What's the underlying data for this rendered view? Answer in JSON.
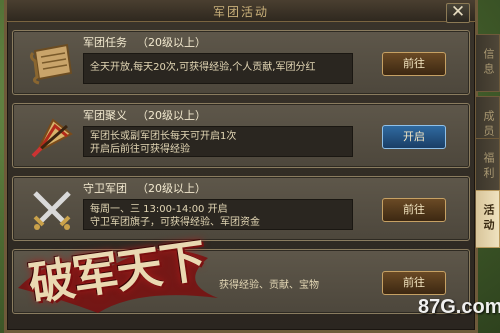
{
  "window": {
    "title": "军团活动",
    "close_label": "✕"
  },
  "activities": [
    {
      "name": "军团任务",
      "level": "（20级以上）",
      "desc_lines": [
        "全天开放,每天20次,可获得经验,个人贡献,军团分红"
      ],
      "button": "前往",
      "icon": "scroll-icon"
    },
    {
      "name": "军团聚义",
      "level": "（20级以上）",
      "desc_lines": [
        "军团长或副军团长每天可开启1次",
        "开启后前往可获得经验"
      ],
      "button": "开启",
      "icon": "war-fan-icon"
    },
    {
      "name": "守卫军团",
      "level": "（20级以上）",
      "desc_lines": [
        "每周一、三 13:00-14:00 开启",
        "守卫军团旗子，可获得经验、军团资金"
      ],
      "button": "前往",
      "icon": "crossed-swords-icon"
    },
    {
      "name": "",
      "level": "",
      "desc_lines": [
        "获得经验、贡献、宝物"
      ],
      "button": "前往",
      "icon": "hidden-icon"
    }
  ],
  "side_tabs": [
    {
      "label": "信息",
      "active": false
    },
    {
      "label": "成员",
      "active": false
    },
    {
      "label": "福利",
      "active": false
    },
    {
      "label": "活动",
      "active": true
    }
  ],
  "logo_text": "破军天下",
  "watermark": "87G.com",
  "colors": {
    "button_gold": "#c6a164",
    "button_blue": "#2f6aa0",
    "panel": "#5e574a"
  }
}
